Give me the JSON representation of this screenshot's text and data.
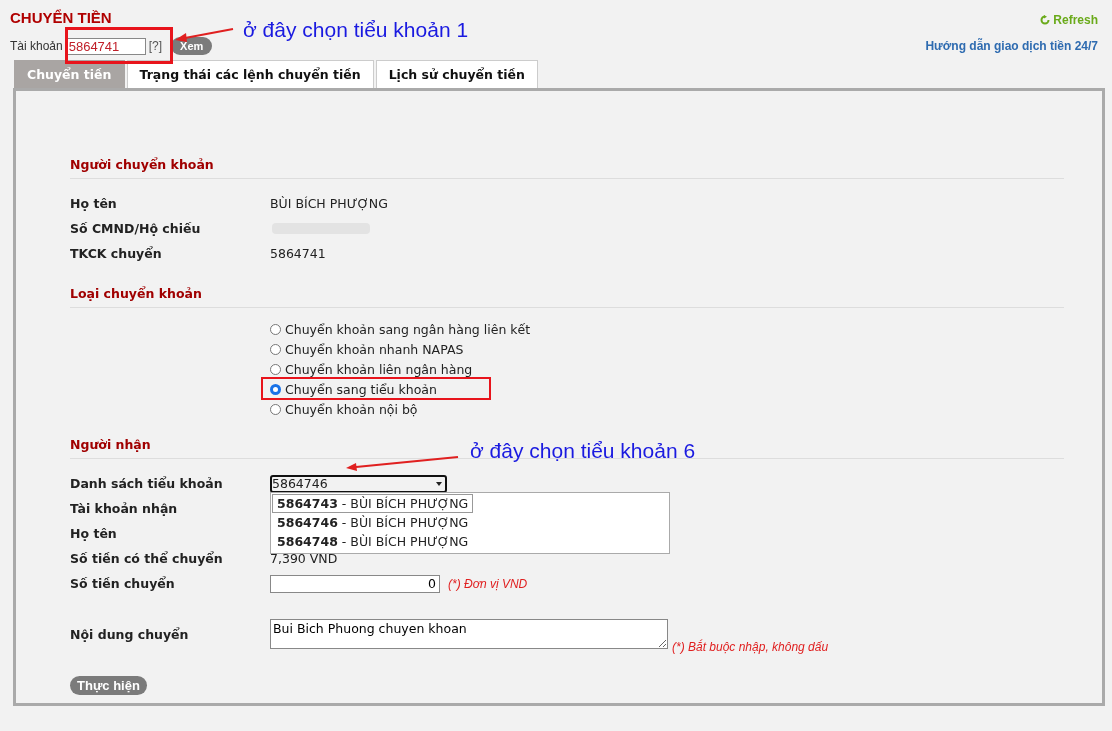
{
  "page": {
    "title": "CHUYỂN TIỀN",
    "refresh": "Refresh",
    "guide_link": "Hướng dẫn giao dịch tiền 24/7"
  },
  "account": {
    "label": "Tài khoản",
    "value": "5864741",
    "help": "[?]",
    "button": "Xem"
  },
  "tabs": [
    {
      "label": "Chuyển tiền",
      "selected": true
    },
    {
      "label": "Trạng thái các lệnh chuyển tiền",
      "selected": false
    },
    {
      "label": "Lịch sử chuyển tiền",
      "selected": false
    }
  ],
  "sender": {
    "title": "Người chuyển khoản",
    "rows": [
      {
        "label": "Họ tên",
        "kind": "text",
        "value": "BÙI BÍCH PHƯỢNG"
      },
      {
        "label": "Số CMND/Hộ chiếu",
        "kind": "redacted"
      },
      {
        "label": "TKCK chuyển",
        "kind": "text",
        "value": "5864741"
      }
    ]
  },
  "transfer_type": {
    "title": "Loại chuyển khoản",
    "options": [
      {
        "label": "Chuyển khoản sang ngân hàng liên kết",
        "selected": false
      },
      {
        "label": "Chuyển khoản nhanh NAPAS",
        "selected": false
      },
      {
        "label": "Chuyển khoản liên ngân hàng",
        "selected": false
      },
      {
        "label": "Chuyển sang tiểu khoản",
        "selected": true
      },
      {
        "label": "Chuyển khoản nội bộ",
        "selected": false
      }
    ]
  },
  "receiver": {
    "title": "Người nhận",
    "rows": [
      {
        "label": "Danh sách tiểu khoản",
        "kind": "select",
        "value": "5864746"
      },
      {
        "label": "Tài khoản nhận",
        "kind": "empty"
      },
      {
        "label": "Họ tên",
        "kind": "empty"
      },
      {
        "label": "Số tiền có thể chuyển",
        "kind": "text",
        "value": "7,390 VND"
      },
      {
        "label": "Số tiền chuyển",
        "kind": "number",
        "value": "0",
        "note": "(*) Đơn vị VND"
      },
      {
        "label": "Nội dung chuyển",
        "kind": "textarea",
        "value": "Bui Bich Phuong chuyen khoan",
        "note": "(*) Bắt buộc nhập, không dấu"
      }
    ]
  },
  "dropdown": {
    "items": [
      {
        "text": "**5864743** - BÙI BÍCH PHƯỢNG",
        "highlighted": true
      },
      {
        "text": "**5864746** - BÙI BÍCH PHƯỢNG",
        "highlighted": false
      },
      {
        "text": "**5864748** - BÙI BÍCH PHƯỢNG",
        "highlighted": false
      }
    ]
  },
  "submit": "Thực hiện",
  "annotations": [
    {
      "text": "ở đây chọn tiểu khoản 1"
    },
    {
      "text": "ở đây chọn tiểu khoản 6"
    }
  ]
}
